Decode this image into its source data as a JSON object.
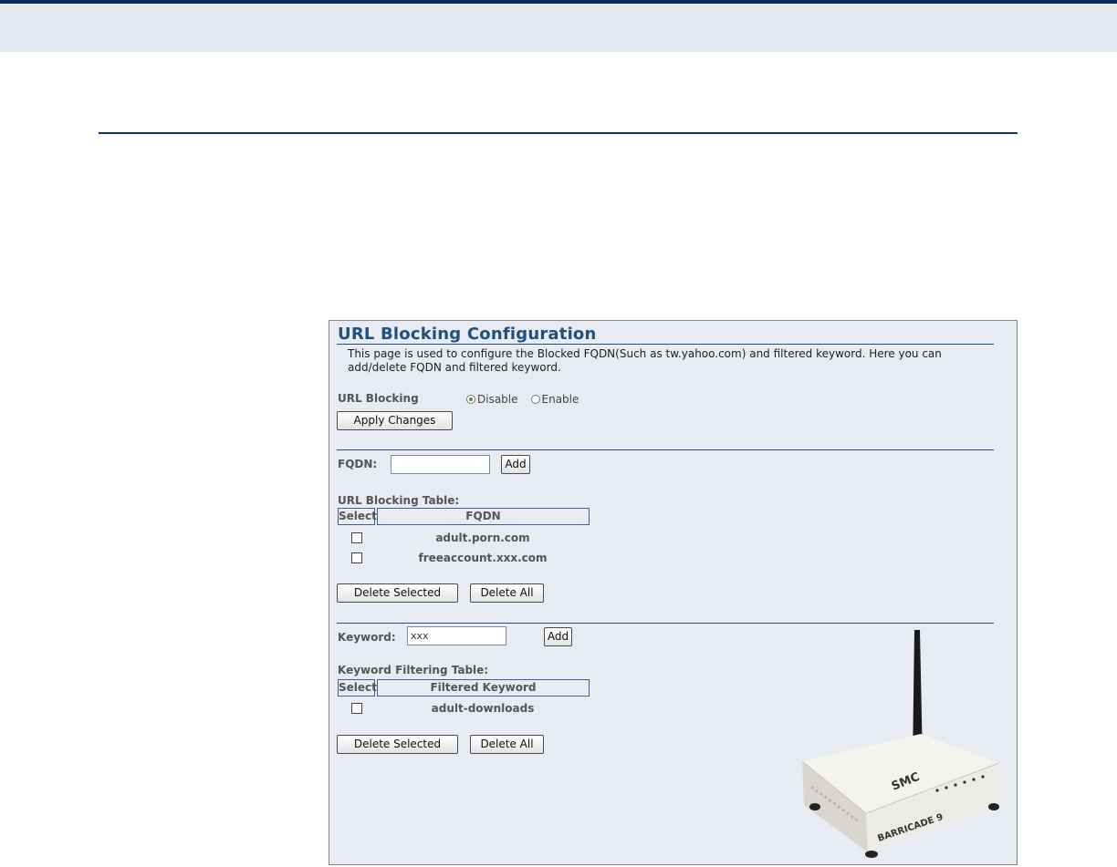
{
  "panel": {
    "title": "URL Blocking Configuration",
    "description": "This page is used to configure the Blocked FQDN(Such as tw.yahoo.com) and filtered keyword. Here you can add/delete FQDN and filtered keyword."
  },
  "url_blocking": {
    "label": "URL Blocking",
    "options": [
      "Disable",
      "Enable"
    ],
    "selected": "Disable",
    "apply_label": "Apply Changes"
  },
  "fqdn": {
    "label": "FQDN:",
    "value": "",
    "add_label": "Add"
  },
  "url_table": {
    "title": "URL Blocking Table:",
    "headers": [
      "Select",
      "FQDN"
    ],
    "rows": [
      {
        "checked": false,
        "value": "adult.porn.com"
      },
      {
        "checked": false,
        "value": "freeaccount.xxx.com"
      }
    ],
    "delete_selected_label": "Delete Selected",
    "delete_all_label": "Delete All"
  },
  "keyword": {
    "label": "Keyword:",
    "value": "xxx",
    "add_label": "Add"
  },
  "keyword_table": {
    "title": "Keyword Filtering Table:",
    "headers": [
      "Select",
      "Filtered Keyword"
    ],
    "rows": [
      {
        "checked": false,
        "value": "adult-downloads"
      }
    ],
    "delete_selected_label": "Delete Selected",
    "delete_all_label": "Delete All"
  },
  "router_branding": {
    "logo": "SMC",
    "model": "BARRICADE 9"
  },
  "colors": {
    "header_band": "#e4e8f1",
    "header_border": "#0b2a5c",
    "panel_bg": "#e8ebf2",
    "title": "#20507f",
    "radio_selected": "#3aa23a"
  }
}
